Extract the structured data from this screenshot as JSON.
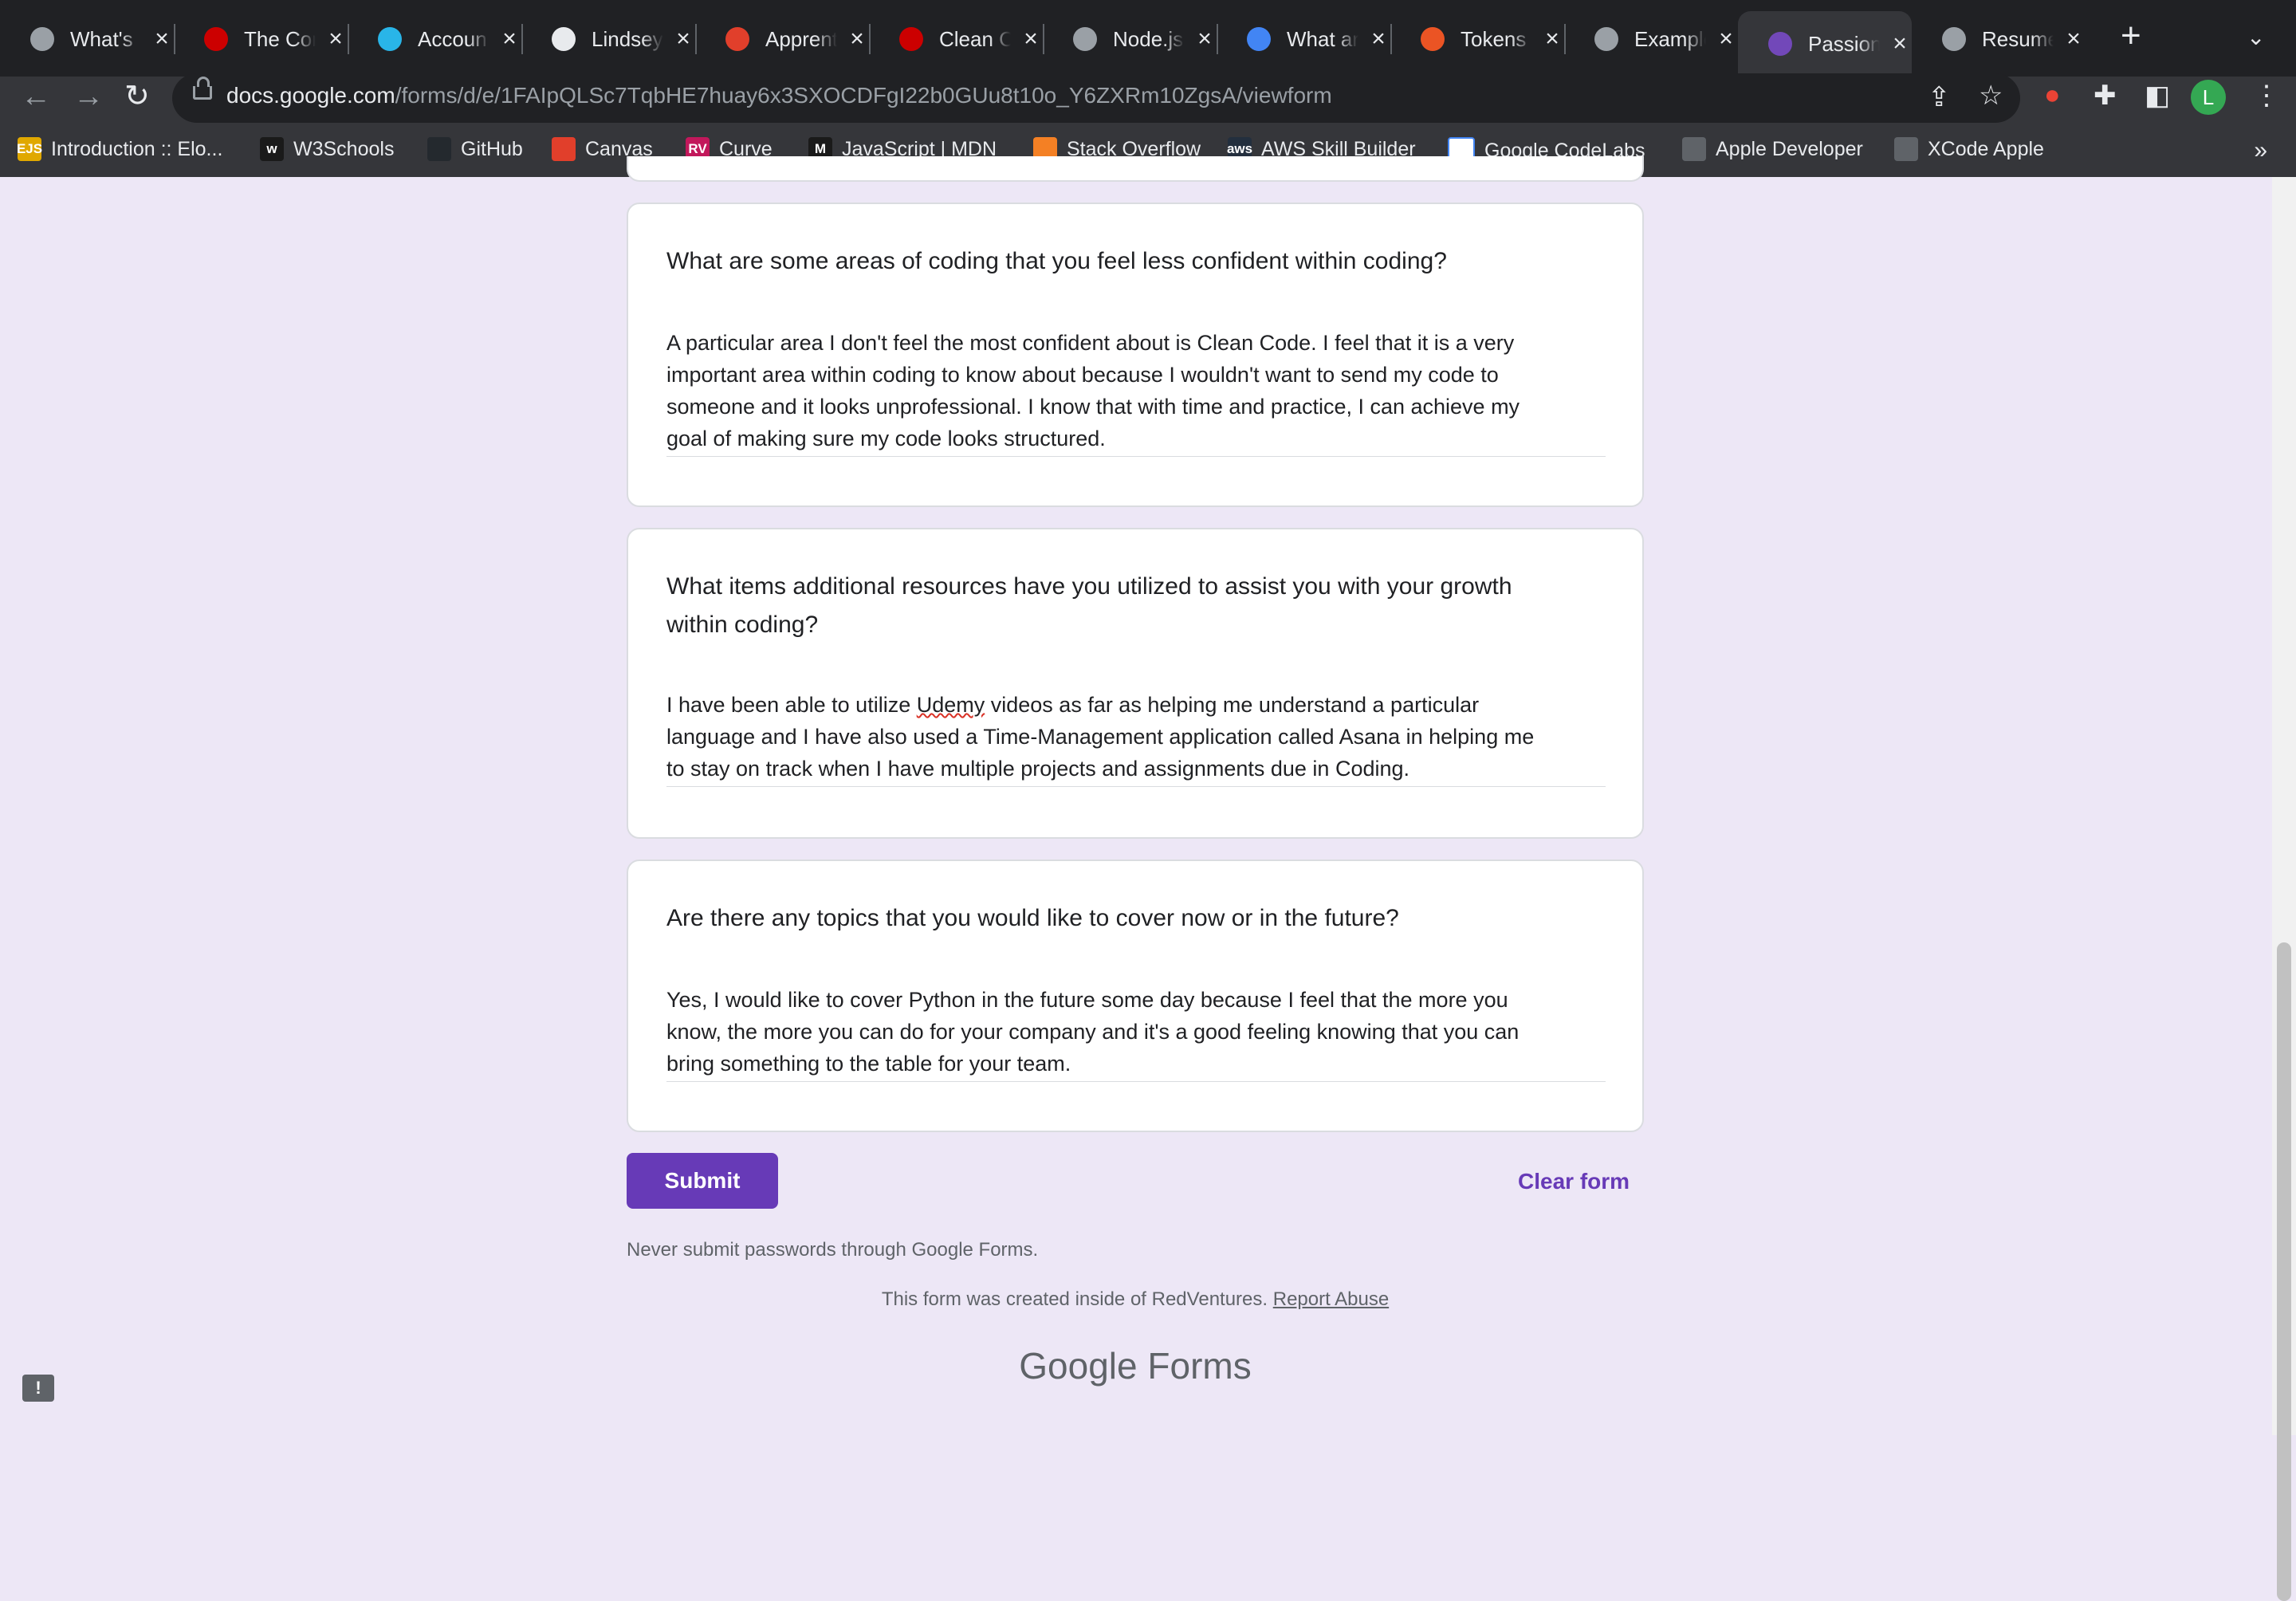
{
  "tabs": [
    {
      "title": "What's",
      "icon": "chrome-icon"
    },
    {
      "title": "The Cor",
      "icon": "rails-icon"
    },
    {
      "title": "Accoun",
      "icon": "snowflake-icon"
    },
    {
      "title": "Lindsey",
      "icon": "github-icon"
    },
    {
      "title": "Apprent",
      "icon": "canvas-icon"
    },
    {
      "title": "Clean C",
      "icon": "rails-icon"
    },
    {
      "title": "Node.js",
      "icon": "openai-icon"
    },
    {
      "title": "What ar",
      "icon": "google-icon"
    },
    {
      "title": "Tokens",
      "icon": "auth0-icon"
    },
    {
      "title": "Example",
      "icon": "globe-icon"
    },
    {
      "title": "Passion",
      "icon": "google-forms-icon"
    },
    {
      "title": "Resume",
      "icon": "globe-icon"
    }
  ],
  "active_tab": 10,
  "address": {
    "host": "docs.google.com",
    "path": "/forms/d/e/1FAIpQLSc7TqbHE7huay6x3SXOCDFgI22b0GUu8t10o_Y6ZXRm10ZgsA/viewform"
  },
  "profile_initial": "L",
  "bookmarks": [
    {
      "label": "Introduction :: Elo...",
      "badge": "EJS"
    },
    {
      "label": "W3Schools",
      "badge": "w"
    },
    {
      "label": "GitHub",
      "badge": ""
    },
    {
      "label": "Canvas",
      "badge": ""
    },
    {
      "label": "Curve",
      "badge": "RV"
    },
    {
      "label": "JavaScript | MDN",
      "badge": "M"
    },
    {
      "label": "Stack Overflow",
      "badge": ""
    },
    {
      "label": "AWS Skill Builder",
      "badge": "aws"
    },
    {
      "label": "Google CodeLabs",
      "badge": ""
    },
    {
      "label": "Apple Developer",
      "badge": ""
    },
    {
      "label": "XCode Apple",
      "badge": ""
    }
  ],
  "form": {
    "questions": [
      {
        "question": "What are some areas of coding that you feel less confident within coding?",
        "answer_lines": [
          "A particular area I don't feel the most confident about is Clean Code. I feel that it is a very",
          "important area within coding to know about because I wouldn't want to send my code to",
          "someone and it looks unprofessional. I know that with time and practice, I can achieve my",
          "goal of making sure my code looks structured."
        ]
      },
      {
        "question_lines": [
          "What items additional resources have you utilized to assist you with your growth",
          "within coding?"
        ],
        "answer_line1_before": "I have been able to utilize ",
        "answer_line1_mark": "Udemy",
        "answer_line1_after": " videos as far as helping me understand a particular",
        "answer_lines": [
          "language and I have also used a Time-Management application called Asana in helping me",
          "to stay on track when I have multiple projects and assignments due in Coding."
        ]
      },
      {
        "question": "Are there any topics that you would like to cover now or in the future?",
        "answer_lines": [
          "Yes, I would like to cover Python in the future some day because I feel that the more you",
          "know, the more you can do for your company and it's a good feeling knowing that you can",
          "bring something to the table for your team."
        ]
      }
    ],
    "submit_label": "Submit",
    "clear_label": "Clear form",
    "password_notice": "Never submit passwords through Google Forms.",
    "created_text": "This form was created inside of RedVentures.",
    "report_label": "Report Abuse",
    "logo_google": "Google",
    "logo_forms": "Forms"
  },
  "colors": {
    "accent": "#673ab7",
    "page_bg": "#ede7f6",
    "chrome_dark": "#202124",
    "chrome_mid": "#35363a"
  }
}
